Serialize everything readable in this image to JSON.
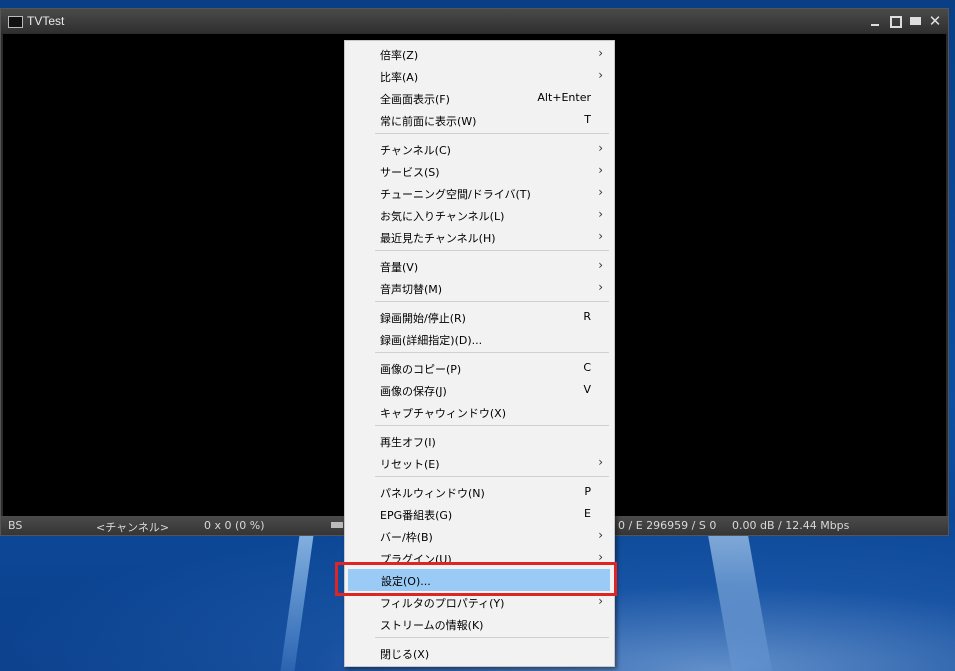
{
  "window": {
    "title": "TVTest",
    "close_glyph": "✕"
  },
  "statusbar": {
    "source": "BS",
    "channel": "<チャンネル>",
    "resolution": "0 x 0 (0 %)",
    "signal": "0 / E 296959 / S 0",
    "rate": "0.00 dB / 12.44 Mbps"
  },
  "menu": {
    "arrow_glyph": "›",
    "items": [
      {
        "label": "倍率(Z)",
        "shortcut": "",
        "submenu": true
      },
      {
        "label": "比率(A)",
        "shortcut": "",
        "submenu": true
      },
      {
        "label": "全画面表示(F)",
        "shortcut": "Alt+Enter",
        "submenu": false
      },
      {
        "label": "常に前面に表示(W)",
        "shortcut": "T",
        "submenu": false
      },
      {
        "label": "チャンネル(C)",
        "shortcut": "",
        "submenu": true
      },
      {
        "label": "サービス(S)",
        "shortcut": "",
        "submenu": true
      },
      {
        "label": "チューニング空間/ドライバ(T)",
        "shortcut": "",
        "submenu": true
      },
      {
        "label": "お気に入りチャンネル(L)",
        "shortcut": "",
        "submenu": true
      },
      {
        "label": "最近見たチャンネル(H)",
        "shortcut": "",
        "submenu": true
      },
      {
        "label": "音量(V)",
        "shortcut": "",
        "submenu": true
      },
      {
        "label": "音声切替(M)",
        "shortcut": "",
        "submenu": true
      },
      {
        "label": "録画開始/停止(R)",
        "shortcut": "R",
        "submenu": false
      },
      {
        "label": "録画(詳細指定)(D)...",
        "shortcut": "",
        "submenu": false
      },
      {
        "label": "画像のコピー(P)",
        "shortcut": "C",
        "submenu": false
      },
      {
        "label": "画像の保存(J)",
        "shortcut": "V",
        "submenu": false
      },
      {
        "label": "キャプチャウィンドウ(X)",
        "shortcut": "",
        "submenu": false
      },
      {
        "label": "再生オフ(I)",
        "shortcut": "",
        "submenu": false
      },
      {
        "label": "リセット(E)",
        "shortcut": "",
        "submenu": true
      },
      {
        "label": "パネルウィンドウ(N)",
        "shortcut": "P",
        "submenu": false
      },
      {
        "label": "EPG番組表(G)",
        "shortcut": "E",
        "submenu": false
      },
      {
        "label": "バー/枠(B)",
        "shortcut": "",
        "submenu": true
      },
      {
        "label": "プラグイン(U)",
        "shortcut": "",
        "submenu": true
      },
      {
        "label": "設定(O)...",
        "shortcut": "",
        "submenu": false,
        "highlighted": true
      },
      {
        "label": "フィルタのプロパティ(Y)",
        "shortcut": "",
        "submenu": true
      },
      {
        "label": "ストリームの情報(K)",
        "shortcut": "",
        "submenu": false
      },
      {
        "label": "閉じる(X)",
        "shortcut": "",
        "submenu": false
      }
    ]
  },
  "colors": {
    "highlight": "#99cbf6",
    "annotation_border": "#e02424"
  }
}
